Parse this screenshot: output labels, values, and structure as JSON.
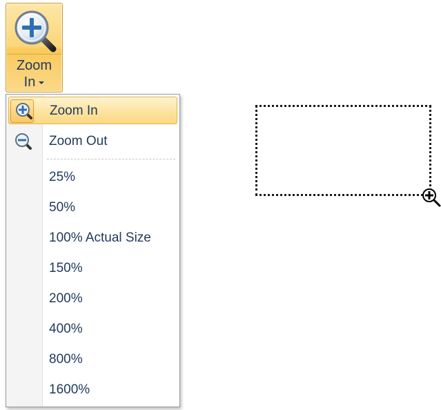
{
  "ribbon_button": {
    "label_line1": "Zoom",
    "label_line2": "In",
    "icon": "zoom-in-magnifier-icon"
  },
  "menu": {
    "items": [
      {
        "label": "Zoom In",
        "icon": "zoom-in-icon",
        "highlighted": true
      },
      {
        "label": "Zoom Out",
        "icon": "zoom-out-icon",
        "highlighted": false
      }
    ],
    "zoom_levels": [
      {
        "label": "25%"
      },
      {
        "label": "50%"
      },
      {
        "label": "100% Actual Size"
      },
      {
        "label": "150%"
      },
      {
        "label": "200%"
      },
      {
        "label": "400%"
      },
      {
        "label": "800%"
      },
      {
        "label": "1600%"
      }
    ]
  },
  "canvas": {
    "cursor_icon": "zoom-in-cursor-icon"
  },
  "colors": {
    "menu_text": "#1e395b",
    "highlight": "#fde3a0",
    "highlight_border": "#e3b24a"
  }
}
